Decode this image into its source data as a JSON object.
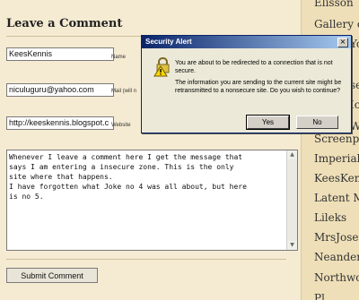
{
  "form": {
    "title": "Leave a Comment",
    "name_value": "KeesKennis",
    "name_label": "Name",
    "mail_value": "niculuguru@yahoo.com",
    "mail_label": "Mail (will n",
    "website_value": "http://keeskennis.blogspot.c",
    "website_label": "Website",
    "comment_text": "Whenever I leave a comment here I get the message that\nsays I am entering a insecure zone. This is the only\nsite where that happens.\nI have forgotten what Joke no 4 was all about, but here\nis no 5.",
    "submit_label": "Submit Comment"
  },
  "sidebar": {
    "items": [
      "Elisson",
      "Gallery of",
      "Yo",
      "sease",
      "Ice",
      "Wr",
      "Screenplay",
      "Imperial C",
      "KeesKenni",
      "Latent Ma",
      "Lileks",
      "MrsJoseG",
      "Neanderpu",
      "Northwoo",
      "Pl"
    ]
  },
  "dialog": {
    "title": "Security Alert",
    "close_glyph": "×",
    "line1": "You are about to be redirected to a connection that is not secure.",
    "line2": "The information you are sending to the current site might be retransmitted to a nonsecure site. Do you wish to continue?",
    "yes_label": "Yes",
    "no_label": "No"
  }
}
